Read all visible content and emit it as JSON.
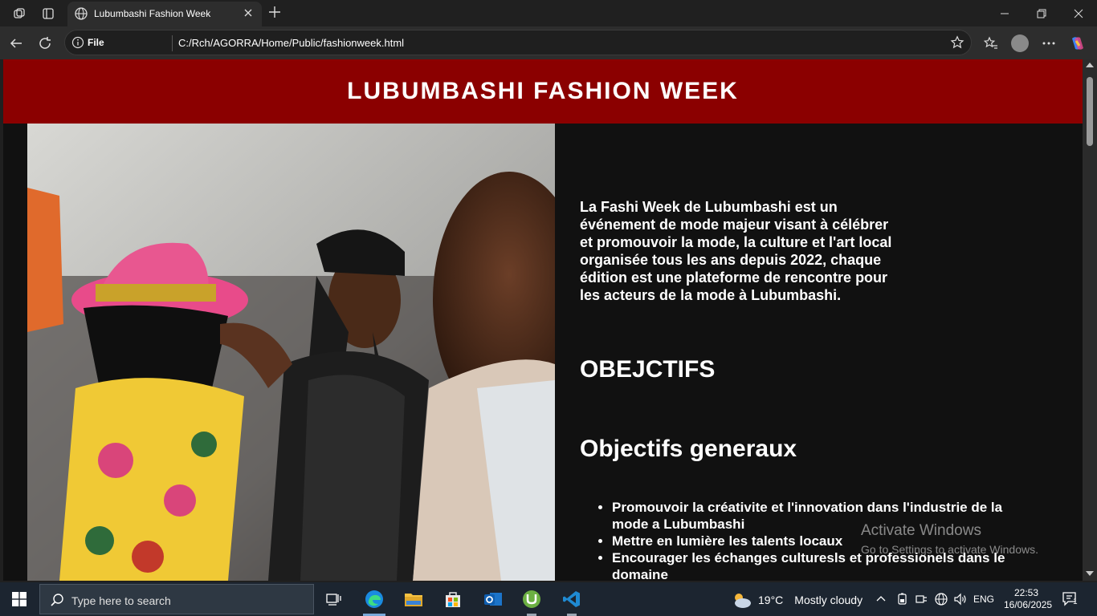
{
  "browser": {
    "tab_title": "Lubumbashi Fashion Week",
    "address_label": "File",
    "url": "C:/Rch/AGORRA/Home/Public/fashionweek.html"
  },
  "page": {
    "header_title": "LUBUMBASHI FASHION WEEK",
    "intro": "La Fashi Week de Lubumbashi est un événement de mode majeur visant à célébrer et promouvoir la mode, la culture et l'art local organisée tous les ans depuis 2022, chaque édition est une plateforme de rencontre pour les acteurs de la mode à Lubumbashi.",
    "heading_objectives": "OBEJCTIFS",
    "heading_general": "Objectifs generaux",
    "objectives": [
      "Promouvoir la créativite et l'innovation dans l'industrie de la mode a Lubumbashi",
      "Mettre en lumière les talents locaux",
      "Encourager les échanges culturesls et professionels dans le domaine"
    ],
    "header_color": "#8b0000"
  },
  "watermark": {
    "line1": "Activate Windows",
    "line2": "Go to Settings to activate Windows."
  },
  "taskbar": {
    "search_placeholder": "Type here to search",
    "weather_temp": "19°C",
    "weather_desc": "Mostly cloudy",
    "lang": "ENG",
    "time": "22:53",
    "date": "16/06/2025",
    "notification_count": "1"
  }
}
